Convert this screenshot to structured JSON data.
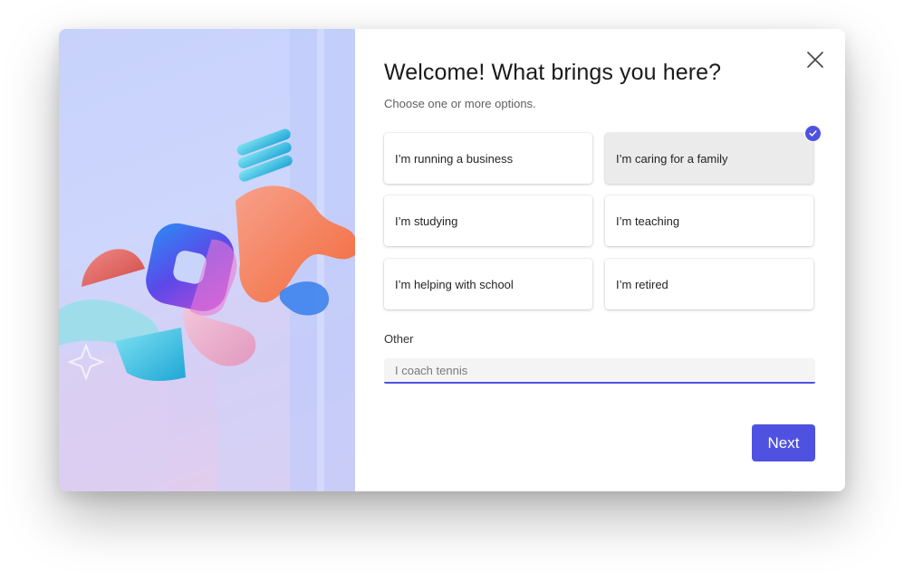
{
  "dialog": {
    "title": "Welcome! What brings you here?",
    "subtitle": "Choose one or more options.",
    "close_icon": "close-icon",
    "options": [
      {
        "label": "I’m running a business",
        "selected": false
      },
      {
        "label": "I’m caring for a family",
        "selected": true
      },
      {
        "label": "I’m studying",
        "selected": false
      },
      {
        "label": "I’m teaching",
        "selected": false
      },
      {
        "label": "I’m helping with school",
        "selected": false
      },
      {
        "label": "I’m retired",
        "selected": false
      }
    ],
    "other": {
      "label": "Other",
      "placeholder": "I coach tennis",
      "value": ""
    },
    "next_label": "Next"
  },
  "hero": {
    "image": "microsoft-365-copilot-3d-logo-illustration"
  },
  "colors": {
    "accent": "#4f52e0",
    "selected_bg": "#ebebeb",
    "hero_bg": "#c7d2fb"
  }
}
